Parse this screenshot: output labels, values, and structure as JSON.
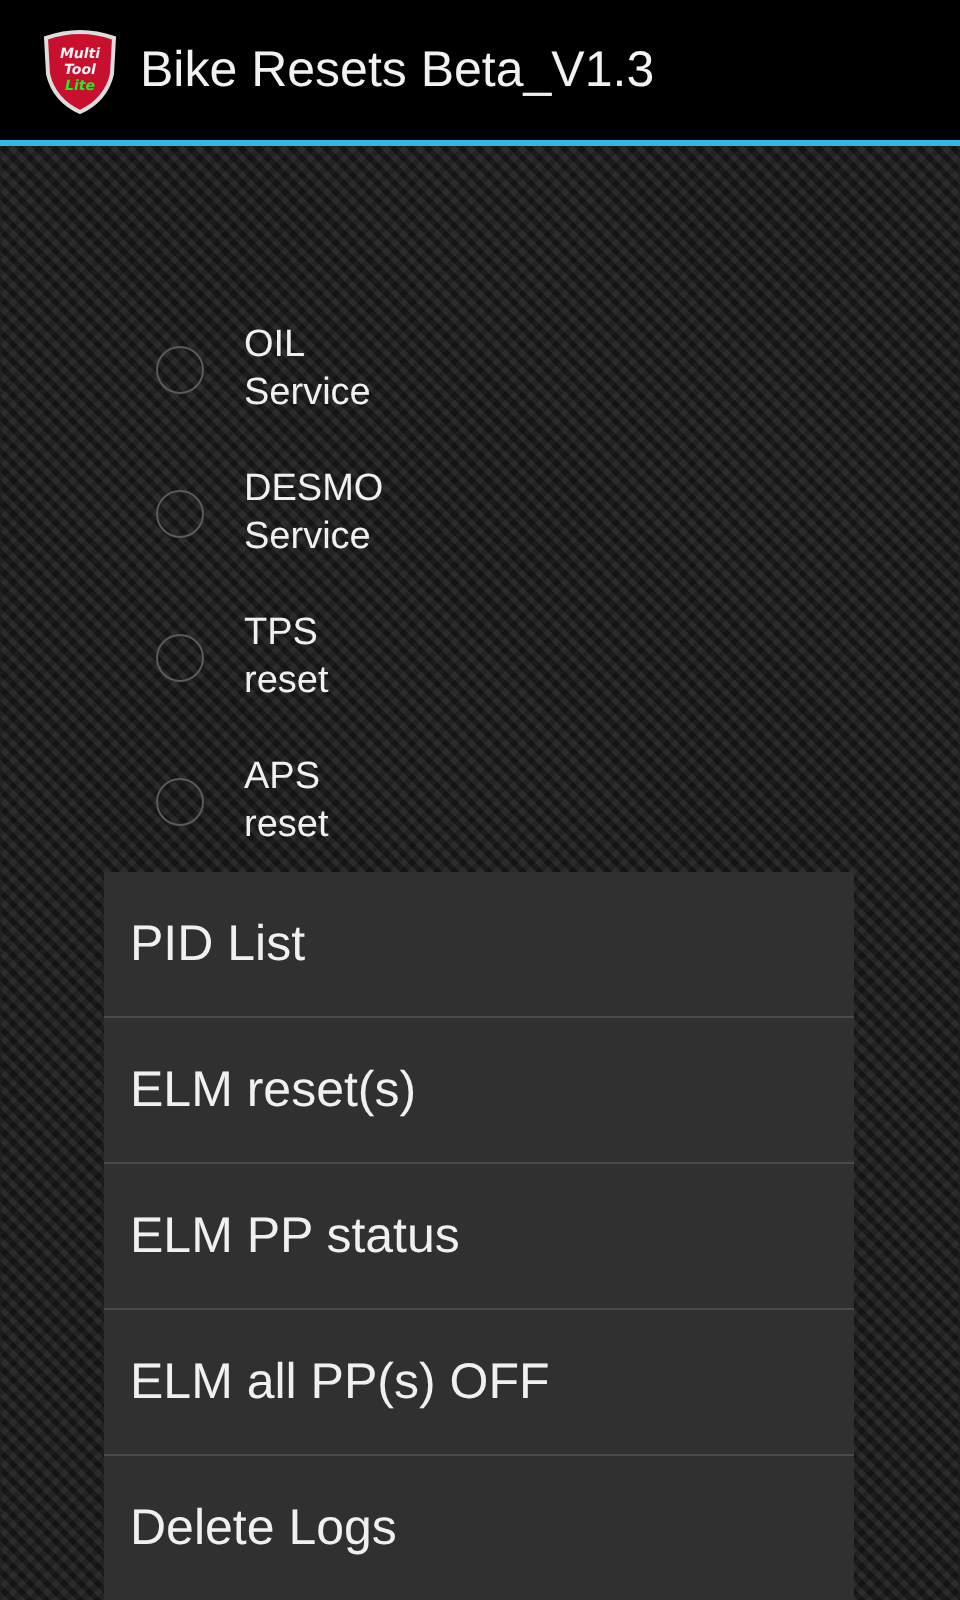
{
  "action_bar": {
    "logo": {
      "line_1": "Multi",
      "line_2": "Tool",
      "line_3": "Lite"
    },
    "title": "Bike Resets Beta_V1.3"
  },
  "options": [
    {
      "lines": [
        "OIL",
        "Service"
      ],
      "selected": false
    },
    {
      "lines": [
        "DESMO",
        "Service"
      ],
      "selected": false
    },
    {
      "lines": [
        "TPS",
        "reset"
      ],
      "selected": false
    },
    {
      "lines": [
        "APS",
        "reset"
      ],
      "selected": false
    }
  ],
  "menu": [
    "PID List",
    "ELM reset(s)",
    "ELM PP status",
    "ELM all PP(s) OFF",
    "Delete Logs"
  ]
}
